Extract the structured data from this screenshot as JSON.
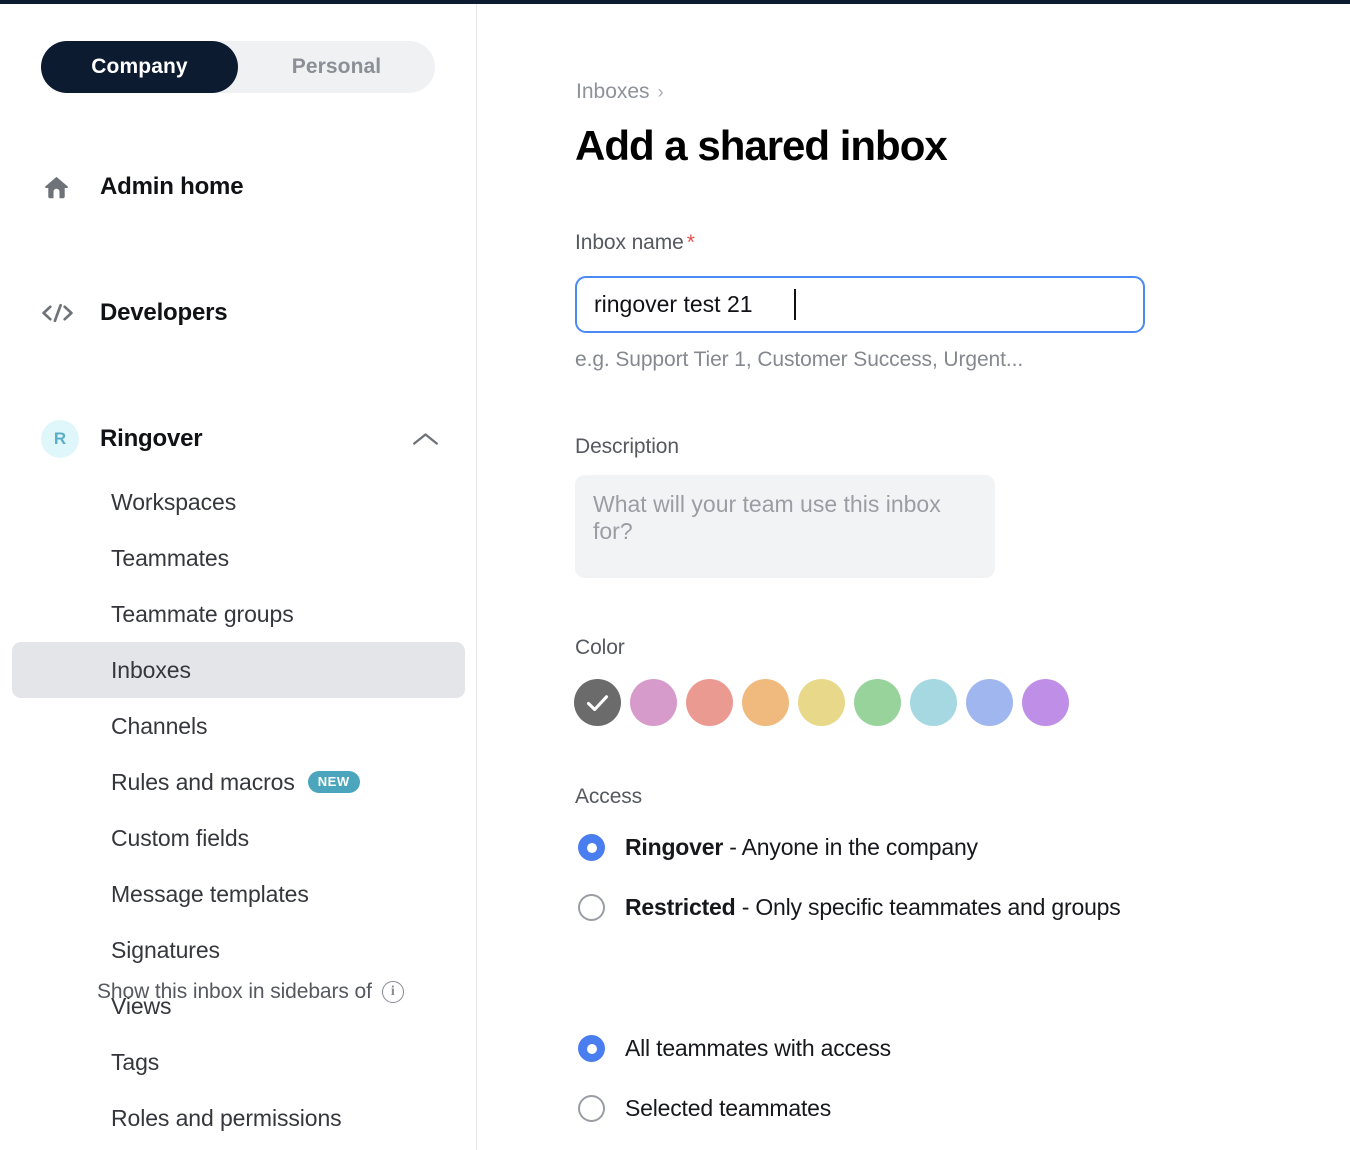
{
  "sidebar": {
    "segmented": {
      "options": [
        "Company",
        "Personal"
      ],
      "selected": "Company",
      "active_bg": "#0d1b31",
      "track_bg": "#f0f1f3"
    },
    "top_nav": [
      {
        "label": "Admin home",
        "icon": "home-icon"
      },
      {
        "label": "Developers",
        "icon": "code-icon"
      }
    ],
    "group": {
      "avatar_letter": "R",
      "avatar_bg": "#dff6fa",
      "avatar_color": "#5aafc6",
      "label": "Ringover",
      "chevron": "chevron-up-icon",
      "expanded": true
    },
    "sub_items": [
      {
        "label": "Workspaces",
        "active": false,
        "badge": null
      },
      {
        "label": "Teammates",
        "active": false,
        "badge": null
      },
      {
        "label": "Teammate groups",
        "active": false,
        "badge": null
      },
      {
        "label": "Inboxes",
        "active": true,
        "badge": null
      },
      {
        "label": "Channels",
        "active": false,
        "badge": null
      },
      {
        "label": "Rules and macros",
        "active": false,
        "badge": "NEW"
      },
      {
        "label": "Custom fields",
        "active": false,
        "badge": null
      },
      {
        "label": "Message templates",
        "active": false,
        "badge": null
      },
      {
        "label": "Signatures",
        "active": false,
        "badge": null
      },
      {
        "label": "Views",
        "active": false,
        "badge": null
      },
      {
        "label": "Tags",
        "active": false,
        "badge": null
      },
      {
        "label": "Roles and permissions",
        "active": false,
        "badge": null
      }
    ],
    "badge_color": "#4ba6bd",
    "active_item_bg": "#e3e5e9"
  },
  "main": {
    "breadcrumb": {
      "parent": "Inboxes",
      "separator": "›"
    },
    "title": "Add a shared inbox",
    "inbox_name": {
      "label": "Inbox name",
      "required_marker": "*",
      "value": "ringover test 21",
      "hint": "e.g. Support Tier 1, Customer Success, Urgent...",
      "focus_border": "#4a8af4"
    },
    "description": {
      "label": "Description",
      "value": "",
      "placeholder": "What will your team use this inbox for?",
      "bg": "#f2f3f5"
    },
    "color": {
      "label": "Color",
      "selected_index": 0,
      "check_glyph": "✓",
      "swatches": [
        {
          "name": "gray",
          "hex": "#6b6b6b"
        },
        {
          "name": "pink",
          "hex": "#d69bca"
        },
        {
          "name": "salmon",
          "hex": "#eb9a91"
        },
        {
          "name": "orange",
          "hex": "#f0b97e"
        },
        {
          "name": "yellow",
          "hex": "#e8d98a"
        },
        {
          "name": "green",
          "hex": "#98d39b"
        },
        {
          "name": "light-blue",
          "hex": "#a5d8e0"
        },
        {
          "name": "periwinkle",
          "hex": "#9fb6ee"
        },
        {
          "name": "purple",
          "hex": "#bf8ee6"
        }
      ]
    },
    "access": {
      "label": "Access",
      "selected": "Ringover",
      "options": [
        {
          "name": "Ringover",
          "description": " - Anyone in the company",
          "selected": true
        },
        {
          "name": "Restricted",
          "description": " - Only specific teammates and groups",
          "selected": false
        }
      ],
      "radio_color": "#4a7ef0"
    },
    "sidebars": {
      "label": "Show this inbox in sidebars of",
      "info_icon": "info-icon",
      "selected": "All teammates with access",
      "options": [
        {
          "name": "All teammates with access",
          "selected": true
        },
        {
          "name": "Selected teammates",
          "selected": false
        }
      ]
    }
  }
}
